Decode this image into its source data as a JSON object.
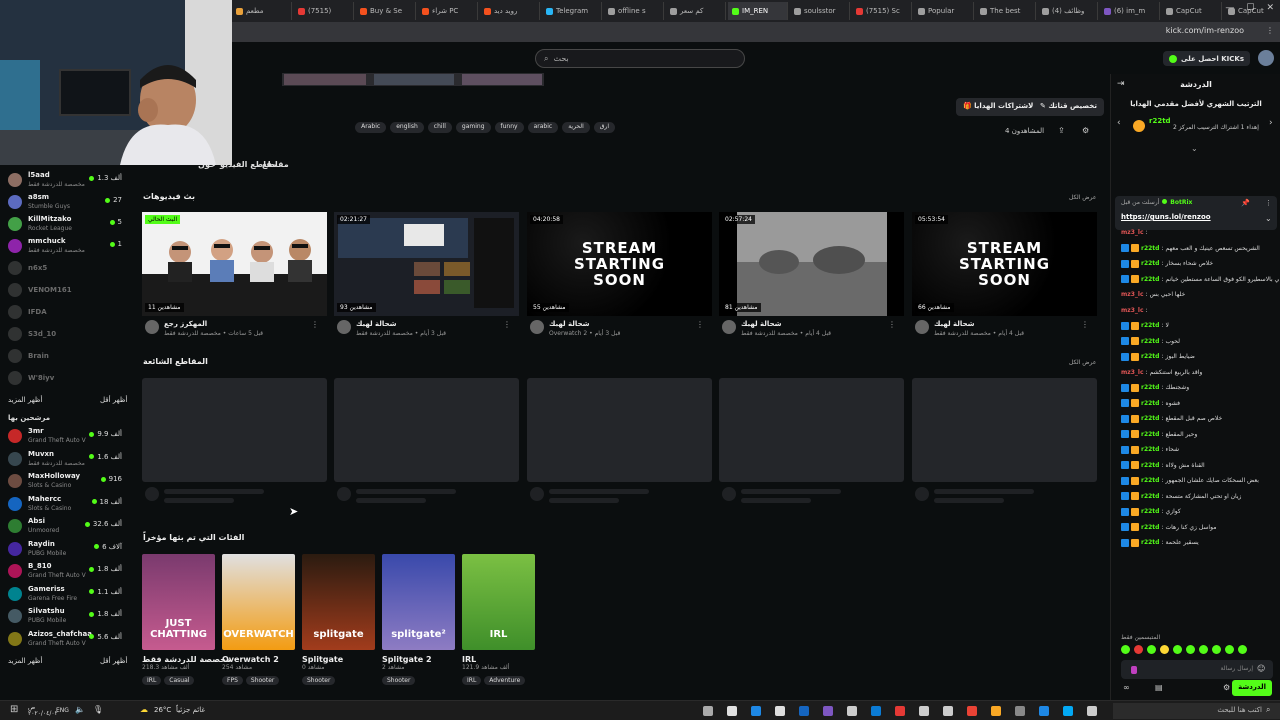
{
  "browser": {
    "tabs": [
      {
        "label": "مطعم",
        "color": "#e9a13b"
      },
      {
        "label": "(7515)",
        "color": "#e53935"
      },
      {
        "label": "Buy & Se",
        "color": "#f4511e"
      },
      {
        "label": "شراء PC",
        "color": "#f4511e"
      },
      {
        "label": "رويد ديد",
        "color": "#f4511e"
      },
      {
        "label": "Telegram",
        "color": "#29b6f6"
      },
      {
        "label": "offline s",
        "color": "#9e9e9e"
      },
      {
        "label": "كم سعر",
        "color": "#9e9e9e"
      },
      {
        "label": "IM_REN",
        "color": "#53fc18"
      },
      {
        "label": "soulsstor",
        "color": "#9e9e9e"
      },
      {
        "label": "(7515) Sc",
        "color": "#e53935"
      },
      {
        "label": "Popular",
        "color": "#9e9e9e"
      },
      {
        "label": "The best",
        "color": "#9e9e9e"
      },
      {
        "label": "(4) وظائف",
        "color": "#9e9e9e"
      },
      {
        "label": "(6) im_m",
        "color": "#7e57c2"
      },
      {
        "label": "CapCut",
        "color": "#9e9e9e"
      },
      {
        "label": "CapCut",
        "color": "#9e9e9e"
      }
    ],
    "url": "kick.com/im-renzoo"
  },
  "topbar": {
    "search_placeholder": "بحث",
    "get_kicks_label": "احصل على KICKs"
  },
  "sidebar": {
    "following": [
      {
        "name": "l5aad",
        "sub": "مخصصة للدردشة فقط",
        "viewers": "1.3 ألف",
        "live": true,
        "color": "#8d6e63"
      },
      {
        "name": "a8sm",
        "sub": "Stumble Guys",
        "viewers": "27",
        "live": true,
        "color": "#5c6bc0"
      },
      {
        "name": "KillMitzako",
        "sub": "Rocket League",
        "viewers": "5",
        "live": true,
        "color": "#43a047"
      },
      {
        "name": "mmchuck",
        "sub": "مخصصة للدردشة فقط",
        "viewers": "1",
        "live": true,
        "color": "#8e24aa"
      },
      {
        "name": "n6x5",
        "sub": "",
        "viewers": "",
        "live": false,
        "color": "#555"
      },
      {
        "name": "VENOM161",
        "sub": "",
        "viewers": "",
        "live": false,
        "color": "#555"
      },
      {
        "name": "IFDA",
        "sub": "",
        "viewers": "",
        "live": false,
        "color": "#555"
      },
      {
        "name": "S3d_10",
        "sub": "",
        "viewers": "",
        "live": false,
        "color": "#555"
      },
      {
        "name": "Brain",
        "sub": "",
        "viewers": "",
        "live": false,
        "color": "#555"
      },
      {
        "name": "W'8iyv",
        "sub": "",
        "viewers": "",
        "live": false,
        "color": "#555"
      }
    ],
    "show_more": "أظهر المزيد",
    "show_less": "أظهر أقل",
    "recommended_title": "مرشحين بها",
    "recommended": [
      {
        "name": "3mr",
        "sub": "Grand Theft Auto V",
        "viewers": "9.9 ألف",
        "color": "#c62828"
      },
      {
        "name": "Muvxn",
        "sub": "مخصصة للدردشة فقط",
        "viewers": "1.6 ألف",
        "color": "#37474f"
      },
      {
        "name": "MaxHolloway",
        "sub": "Slots & Casino",
        "viewers": "916",
        "color": "#6d4c41"
      },
      {
        "name": "Mahercc",
        "sub": "Slots & Casino",
        "viewers": "18 ألف",
        "color": "#1565c0"
      },
      {
        "name": "Absi",
        "sub": "Unmoored",
        "viewers": "32.6 ألف",
        "color": "#2e7d32"
      },
      {
        "name": "Raydin",
        "sub": "PUBG Mobile",
        "viewers": "6 آلاف",
        "color": "#4527a0"
      },
      {
        "name": "B_810",
        "sub": "Grand Theft Auto V",
        "viewers": "1.8 ألف",
        "color": "#ad1457"
      },
      {
        "name": "Gameriss",
        "sub": "Garena Free Fire",
        "viewers": "1.1 ألف",
        "color": "#00838f"
      },
      {
        "name": "Silvatshu",
        "sub": "PUBG Mobile",
        "viewers": "1.8 ألف",
        "color": "#455a64"
      },
      {
        "name": "Azizos_chafchaa",
        "sub": "Grand Theft Auto V",
        "viewers": "5.6 ألف",
        "color": "#827717"
      }
    ],
    "show_more_2": "أظهر المزيد",
    "show_less_2": "أظهر أقل"
  },
  "channel": {
    "tags": [
      "Arabic",
      "english",
      "chill",
      "gaming",
      "funny",
      "arabic",
      "الحرية",
      "ارق"
    ],
    "subs_button": "الاشتراكات الهدايا",
    "customize_button": "تخصيص قناتك",
    "followers": "4 المشاهدون",
    "nav_tabs": [
      "مقاطع",
      "مقاطع الفيديو",
      "حول"
    ]
  },
  "videos_section": {
    "title": "بث فيديوهات",
    "view_all": "عرض الكل",
    "cards": [
      {
        "duration": "البث الحالي",
        "views": "11 مشاهدين",
        "title": "المهكرز رجع",
        "meta": "قبل 5 ساعات • مخصصة للدردشة فقط",
        "kind": "people"
      },
      {
        "duration": "02:21:27",
        "views": "93 مشاهدين",
        "title": "شحالة لهبك",
        "meta": "قبل 3 أيام • مخصصة للدردشة فقط",
        "kind": "screen"
      },
      {
        "duration": "04:20:58",
        "views": "55 مشاهدين",
        "title": "شحالة لهبك",
        "meta": "Overwatch 2 • قبل 3 أيام",
        "kind": "starting"
      },
      {
        "duration": "02:57:24",
        "views": "81 مشاهدين",
        "title": "شحالة لهبك",
        "meta": "قبل 4 أيام • مخصصة للدردشة فقط",
        "kind": "landscape"
      },
      {
        "duration": "05:53:54",
        "views": "66 مشاهدين",
        "title": "شحالة لهبك",
        "meta": "قبل 4 أيام • مخصصة للدردشة فقط",
        "kind": "starting"
      }
    ],
    "starting_text": [
      "STREAM",
      "STARTING",
      "SOON"
    ]
  },
  "clips_section": {
    "title": "المقاطع الشائعة",
    "view_all": "عرض الكل"
  },
  "categories_section": {
    "title": "الفئات التي تم بثها مؤخراً",
    "items": [
      {
        "name": "مخصصة للدردشة فقط",
        "views": "218.3 ألف مشاهد",
        "tags": [
          "IRL",
          "Casual"
        ],
        "art": "JUST CHATTING",
        "bg": "linear-gradient(180deg,#7a3a6e,#c65b8f)"
      },
      {
        "name": "Overwatch 2",
        "views": "254 مشاهد",
        "tags": [
          "FPS",
          "Shooter"
        ],
        "art": "OVERWATCH",
        "bg": "linear-gradient(180deg,#e0e0e0,#f39c12)"
      },
      {
        "name": "Splitgate",
        "views": "0 مشاهد",
        "tags": [
          "Shooter"
        ],
        "art": "splitgate",
        "bg": "linear-gradient(180deg,#2b1b10,#a23c1c)"
      },
      {
        "name": "Splitgate 2",
        "views": "2 مشاهد",
        "tags": [
          "Shooter"
        ],
        "art": "splitgate²",
        "bg": "linear-gradient(180deg,#3949ab,#8e7cc3)"
      },
      {
        "name": "IRL",
        "views": "121.9 ألف مشاهد",
        "tags": [
          "IRL",
          "Adventure"
        ],
        "art": "IRL",
        "bg": "linear-gradient(180deg,#7bc043,#3f8f2a)"
      }
    ]
  },
  "chat": {
    "title": "الدردشة",
    "leaderboard_title": "الترتيب الشهري لأفضل مقدمي الهدايا",
    "leader_name": "r22td",
    "leader_text": "إهداء 1 اشتراك الترسيب المركز 2",
    "pinned_user": "BotRix",
    "pinned_prefix": "أرسلت من قبل",
    "pinned_link": "https://guns.lol/renzoo",
    "messages": [
      {
        "user": "mz3_lc",
        "text": "",
        "alt": true
      },
      {
        "user": "r22td",
        "text": "الشريحس تسعص عينيك و العب معهم"
      },
      {
        "user": "r22td",
        "text": "خلاص شحاء بسخار"
      },
      {
        "user": "r22td",
        "text": "الي بالاسطيرو الكو فوق الساعة مستطين خيانم"
      },
      {
        "user": "mz3_lc",
        "text": "خلها احبي بس",
        "alt": true
      },
      {
        "user": "mz3_lc",
        "text": "",
        "alt": true
      },
      {
        "user": "r22td",
        "text": "لا"
      },
      {
        "user": "r22td",
        "text": "لحوب"
      },
      {
        "user": "r22td",
        "text": "ضيايط البوز"
      },
      {
        "user": "mz3_lc",
        "text": "واقد بالربيع استنكشم",
        "alt": true
      },
      {
        "user": "r22td",
        "text": "وشجنطك"
      },
      {
        "user": "r22td",
        "text": "فشوه"
      },
      {
        "user": "r22td",
        "text": "خلاص صم قبل المقطع"
      },
      {
        "user": "r22td",
        "text": "وحير المقطع"
      },
      {
        "user": "r22td",
        "text": "شحاء"
      },
      {
        "user": "r22td",
        "text": "القناة مش ولااه"
      },
      {
        "user": "r22td",
        "text": "بعض السحكات صايك علشان الجمهور"
      },
      {
        "user": "r22td",
        "text": "زيان او تحتي المشاركة متسحة"
      },
      {
        "user": "r22td",
        "text": "كوازي"
      },
      {
        "user": "r22td",
        "text": "مواسل زي كنا رهات"
      },
      {
        "user": "r22td",
        "text": "يسقير علحمة"
      }
    ],
    "input_placeholder": "إرسال رسالة",
    "send_label": "الدردشة",
    "emotes_label": "المتبسمين فقط"
  },
  "taskbar": {
    "weather": "26°C",
    "weather_text": "غائم جزئياً",
    "language": "ENG",
    "time": "ص",
    "date": "٢٠٢٠/٠٤/٠٢",
    "search_placeholder": "اكتب هنا للبحث"
  }
}
